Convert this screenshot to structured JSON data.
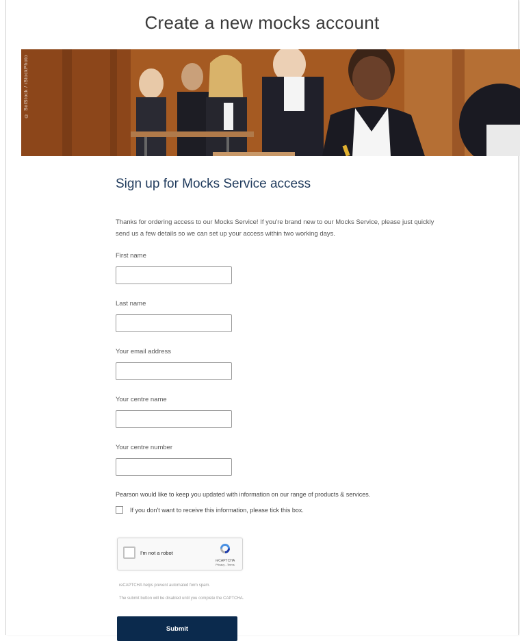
{
  "page": {
    "title": "Create a new mocks account",
    "hero_credit": "© SolStock / iStockPhoto"
  },
  "form": {
    "heading": "Sign up for Mocks Service access",
    "intro": "Thanks for ordering access to our Mocks Service! If you're brand new to our Mocks Service, please just quickly send us a few details so we can set up your access within two working days.",
    "fields": [
      {
        "label": "First name",
        "value": ""
      },
      {
        "label": "Last name",
        "value": ""
      },
      {
        "label": "Your email address",
        "value": ""
      },
      {
        "label": "Your centre name",
        "value": ""
      },
      {
        "label": "Your centre number",
        "value": ""
      }
    ],
    "consent_text": "Pearson would like to keep you updated with information on our range of products & services.",
    "optout_label": "If you don't want to receive this information, please tick this box.",
    "optout_checked": false,
    "recaptcha": {
      "label": "I'm not a robot",
      "brand": "reCAPTCHA",
      "links": "Privacy - Terms"
    },
    "recaptcha_note": "reCAPTCHA helps prevent automated form spam.",
    "submit_note": "The submit button will be disabled until you complete the CAPTCHA.",
    "submit_label": "Submit"
  },
  "colors": {
    "heading": "#1f3a5c",
    "submit_bg": "#0b2a4d"
  }
}
